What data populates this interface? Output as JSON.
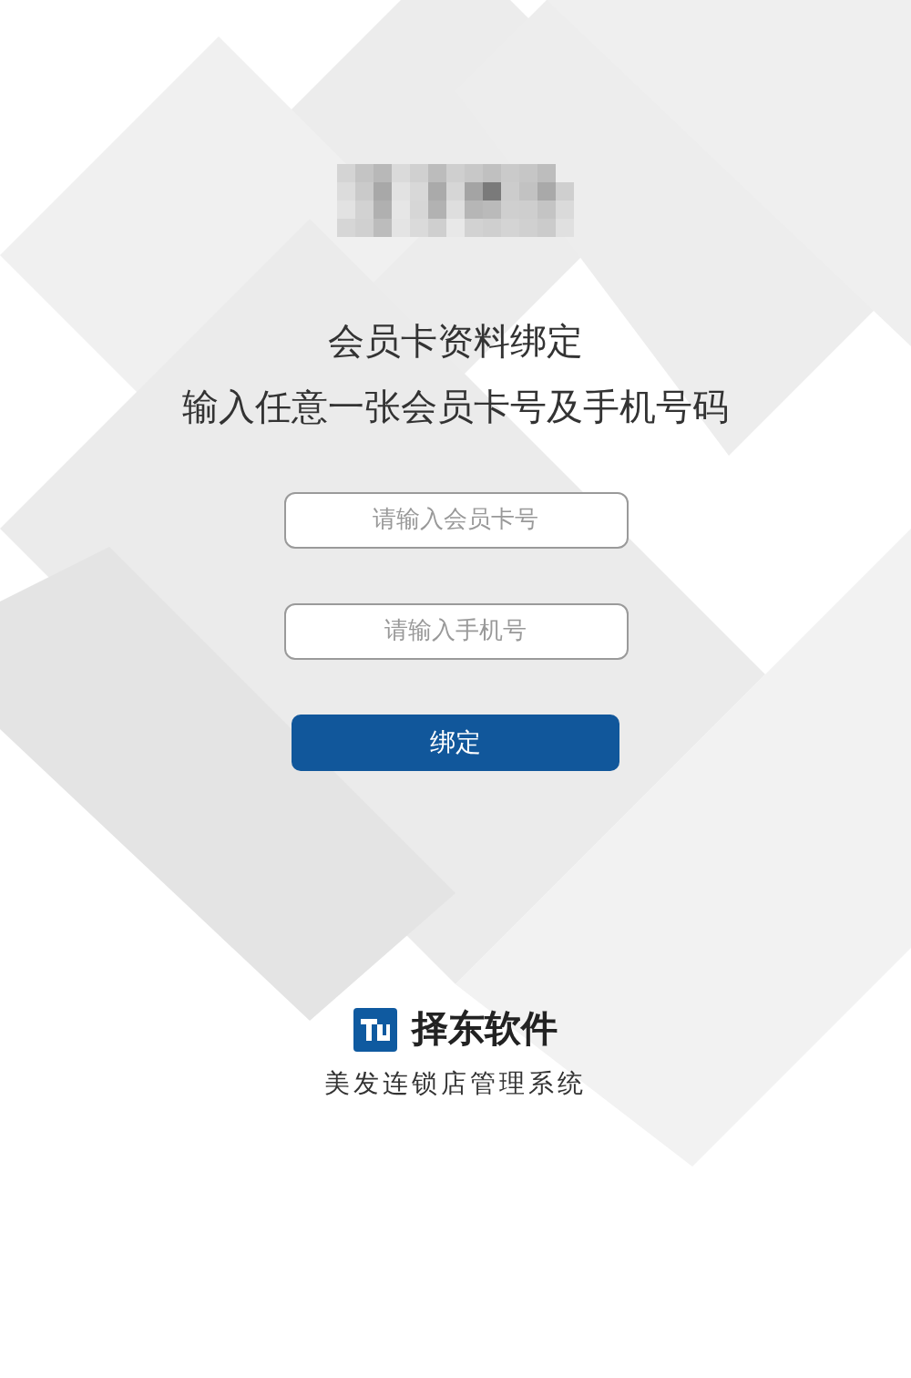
{
  "heading": {
    "title": "会员卡资料绑定",
    "subtitle": "输入任意一张会员卡号及手机号码"
  },
  "fields": [
    {
      "placeholder": "请输入会员卡号"
    },
    {
      "placeholder": "请输入手机号"
    }
  ],
  "submit_button": {
    "label": "绑定"
  },
  "brand": {
    "name": "择东软件",
    "tagline": "美发连锁店管理系统"
  }
}
